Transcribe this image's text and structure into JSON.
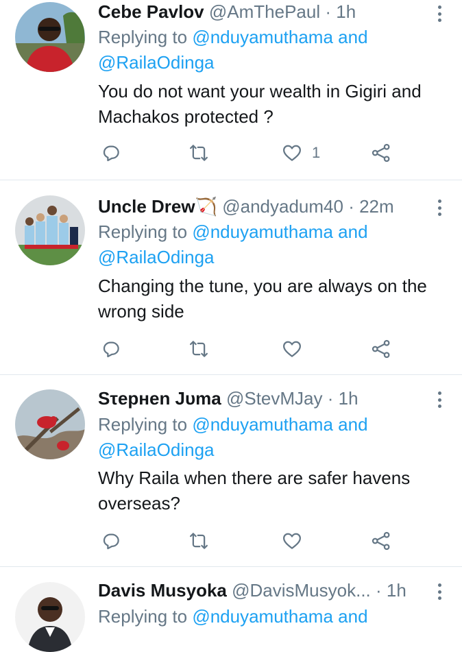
{
  "tweets": [
    {
      "name": "Cebe Pavlov",
      "handle": "@AmThePaul",
      "separator": "·",
      "time": "1h",
      "replying_prefix": "Replying to",
      "mention1": "@nduyamuthama",
      "and": "and",
      "mention2": "@RailaOdinga",
      "text": "You do not want your wealth in Gigiri and Machakos protected ?",
      "like_count": "1"
    },
    {
      "name": "Uncle Drew🏹",
      "handle": "@andyadum40",
      "separator": "·",
      "time": "22m",
      "replying_prefix": "Replying to",
      "mention1": "@nduyamuthama",
      "and": "and",
      "mention2": "@RailaOdinga",
      "text": "Changing the tune, you are always on the wrong side",
      "like_count": ""
    },
    {
      "name": "Sτepнen Jυma",
      "handle": "@StevMJay",
      "separator": "·",
      "time": "1h",
      "replying_prefix": "Replying to",
      "mention1": "@nduyamuthama",
      "and": "and",
      "mention2": "@RailaOdinga",
      "text": "Why Raila when there are safer havens overseas?",
      "like_count": ""
    },
    {
      "name": "Davis Musyoka",
      "handle": "@DavisMusyok...",
      "separator": "·",
      "time": "1h",
      "replying_prefix": "Replying to",
      "mention1": "@nduyamuthama",
      "and": "and"
    }
  ],
  "icons": {
    "reply": "reply-icon",
    "retweet": "retweet-icon",
    "like": "heart-icon",
    "share": "share-icon",
    "more": "more-options-icon"
  },
  "colors": {
    "mention": "#1da1f2",
    "secondary_text": "#657786",
    "divider": "#e1e8ed"
  }
}
